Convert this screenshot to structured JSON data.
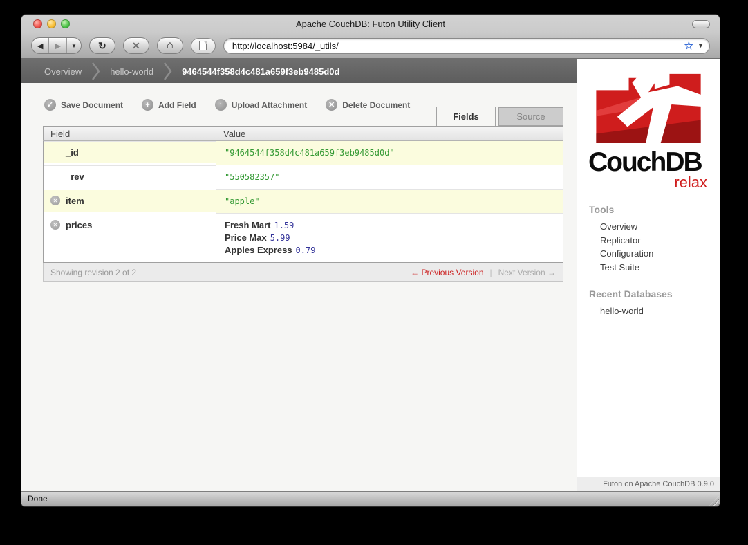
{
  "colors": {
    "accent_red": "#cc2222",
    "string_green": "#339933",
    "number_blue": "#333399",
    "logo_red": "#cf1d1d"
  },
  "window": {
    "title": "Apache CouchDB: Futon Utility Client",
    "status_text": "Done"
  },
  "browser": {
    "url": "http://localhost:5984/_utils/"
  },
  "breadcrumb": {
    "links": [
      "Overview",
      "hello-world"
    ],
    "current": "9464544f358d4c481a659f3eb9485d0d"
  },
  "commands": [
    {
      "label": "Save Document",
      "icon": "check-circle-icon",
      "glyph": "✓"
    },
    {
      "label": "Add Field",
      "icon": "plus-circle-icon",
      "glyph": "+"
    },
    {
      "label": "Upload Attachment",
      "icon": "arrow-up-circle-icon",
      "glyph": "↑"
    },
    {
      "label": "Delete Document",
      "icon": "x-circle-icon",
      "glyph": "✕"
    }
  ],
  "tabs": [
    {
      "label": "Fields",
      "active": true
    },
    {
      "label": "Source",
      "active": false
    }
  ],
  "doc_table": {
    "columns": [
      "Field",
      "Value"
    ],
    "rows": [
      {
        "field": "_id",
        "deletable": false,
        "value_type": "string",
        "value": "\"9464544f358d4c481a659f3eb9485d0d\""
      },
      {
        "field": "_rev",
        "deletable": false,
        "value_type": "string",
        "value": "\"550582357\""
      },
      {
        "field": "item",
        "deletable": true,
        "value_type": "string",
        "value": "\"apple\""
      },
      {
        "field": "prices",
        "deletable": true,
        "value_type": "object",
        "entries": [
          {
            "key": "Fresh Mart",
            "value": "1.59"
          },
          {
            "key": "Price Max",
            "value": "5.99"
          },
          {
            "key": "Apples Express",
            "value": "0.79"
          }
        ]
      }
    ]
  },
  "revision_bar": {
    "status": "Showing revision 2 of 2",
    "prev_label": "← Previous Version",
    "separator": "|",
    "next_label": "Next Version →"
  },
  "sidebar": {
    "logo_title": "CouchDB",
    "logo_tagline": "relax",
    "sections": [
      {
        "heading": "Tools",
        "items": [
          "Overview",
          "Replicator",
          "Configuration",
          "Test Suite"
        ]
      },
      {
        "heading": "Recent Databases",
        "items": [
          "hello-world"
        ]
      }
    ],
    "footer": "Futon on Apache CouchDB 0.9.0"
  }
}
